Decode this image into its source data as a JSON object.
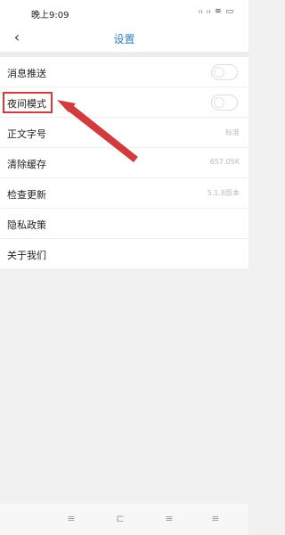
{
  "status_bar": {
    "time": "晚上9:09",
    "icons": "ᵢₗ ᵢₗ ≋ ▭"
  },
  "nav": {
    "back_icon": "‹",
    "title": "设置"
  },
  "settings": {
    "items": [
      {
        "label": "消息推送",
        "type": "toggle",
        "enabled": false
      },
      {
        "label": "夜间模式",
        "type": "toggle",
        "enabled": false
      },
      {
        "label": "正文字号",
        "type": "value",
        "value": "标准"
      },
      {
        "label": "清除缓存",
        "type": "value",
        "value": "657.05K"
      },
      {
        "label": "检查更新",
        "type": "value",
        "value": "5.1.8版本"
      },
      {
        "label": "隐私政策",
        "type": "link"
      },
      {
        "label": "关于我们",
        "type": "link"
      }
    ]
  },
  "annotation": {
    "color": "#d13b3b"
  },
  "bottom_bar": {
    "keys": [
      "≡",
      "⊏",
      "≡",
      "≡"
    ]
  }
}
